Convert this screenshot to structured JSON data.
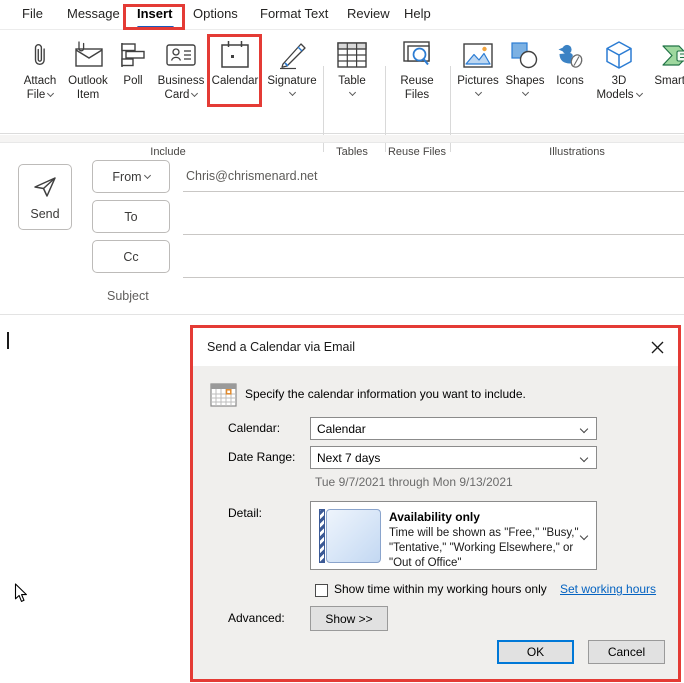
{
  "menu": {
    "items": [
      "File",
      "Message",
      "Insert",
      "Options",
      "Format Text",
      "Review",
      "Help"
    ],
    "active_tab": "Insert"
  },
  "ribbon": {
    "buttons": [
      {
        "line1": "Attach",
        "line2": "File"
      },
      {
        "line1": "Outlook",
        "line2": "Item"
      },
      {
        "line1": "Poll",
        "line2": ""
      },
      {
        "line1": "Business",
        "line2": "Card"
      },
      {
        "line1": "Calendar",
        "line2": ""
      },
      {
        "line1": "Signature",
        "line2": ""
      },
      {
        "line1": "Table",
        "line2": ""
      },
      {
        "line1": "Reuse",
        "line2": "Files"
      },
      {
        "line1": "Pictures",
        "line2": ""
      },
      {
        "line1": "Shapes",
        "line2": ""
      },
      {
        "line1": "Icons",
        "line2": ""
      },
      {
        "line1": "3D",
        "line2": "Models"
      },
      {
        "line1": "SmartArt",
        "line2": ""
      }
    ],
    "groups": [
      "Include",
      "Tables",
      "Reuse Files",
      "Illustrations"
    ]
  },
  "compose": {
    "send_label": "Send",
    "from_label": "From",
    "to_label": "To",
    "cc_label": "Cc",
    "subject_label": "Subject",
    "from_value": "Chris@chrismenard.net"
  },
  "dialog": {
    "title": "Send a Calendar via Email",
    "intro": "Specify the calendar information you want to include.",
    "calendar_label": "Calendar:",
    "calendar_value": "Calendar",
    "date_range_label": "Date Range:",
    "date_range_value": "Next 7 days",
    "date_range_note": "Tue 9/7/2021 through Mon 9/13/2021",
    "detail_label": "Detail:",
    "detail": {
      "title": "Availability only",
      "description": "Time will be shown as \"Free,\" \"Busy,\" \"Tentative,\" \"Working Elsewhere,\" or \"Out of Office\""
    },
    "working_hours_checkbox_label": "Show time within my working hours only",
    "working_hours_checked": false,
    "set_working_hours_link": "Set working hours",
    "advanced_label": "Advanced:",
    "show_button_label": "Show >>",
    "ok_button_label": "OK",
    "cancel_button_label": "Cancel"
  },
  "colors": {
    "annotation_red": "#e43b35",
    "accent_blue": "#185abd",
    "link_blue": "#0563c1",
    "ok_border_blue": "#0078d7"
  }
}
